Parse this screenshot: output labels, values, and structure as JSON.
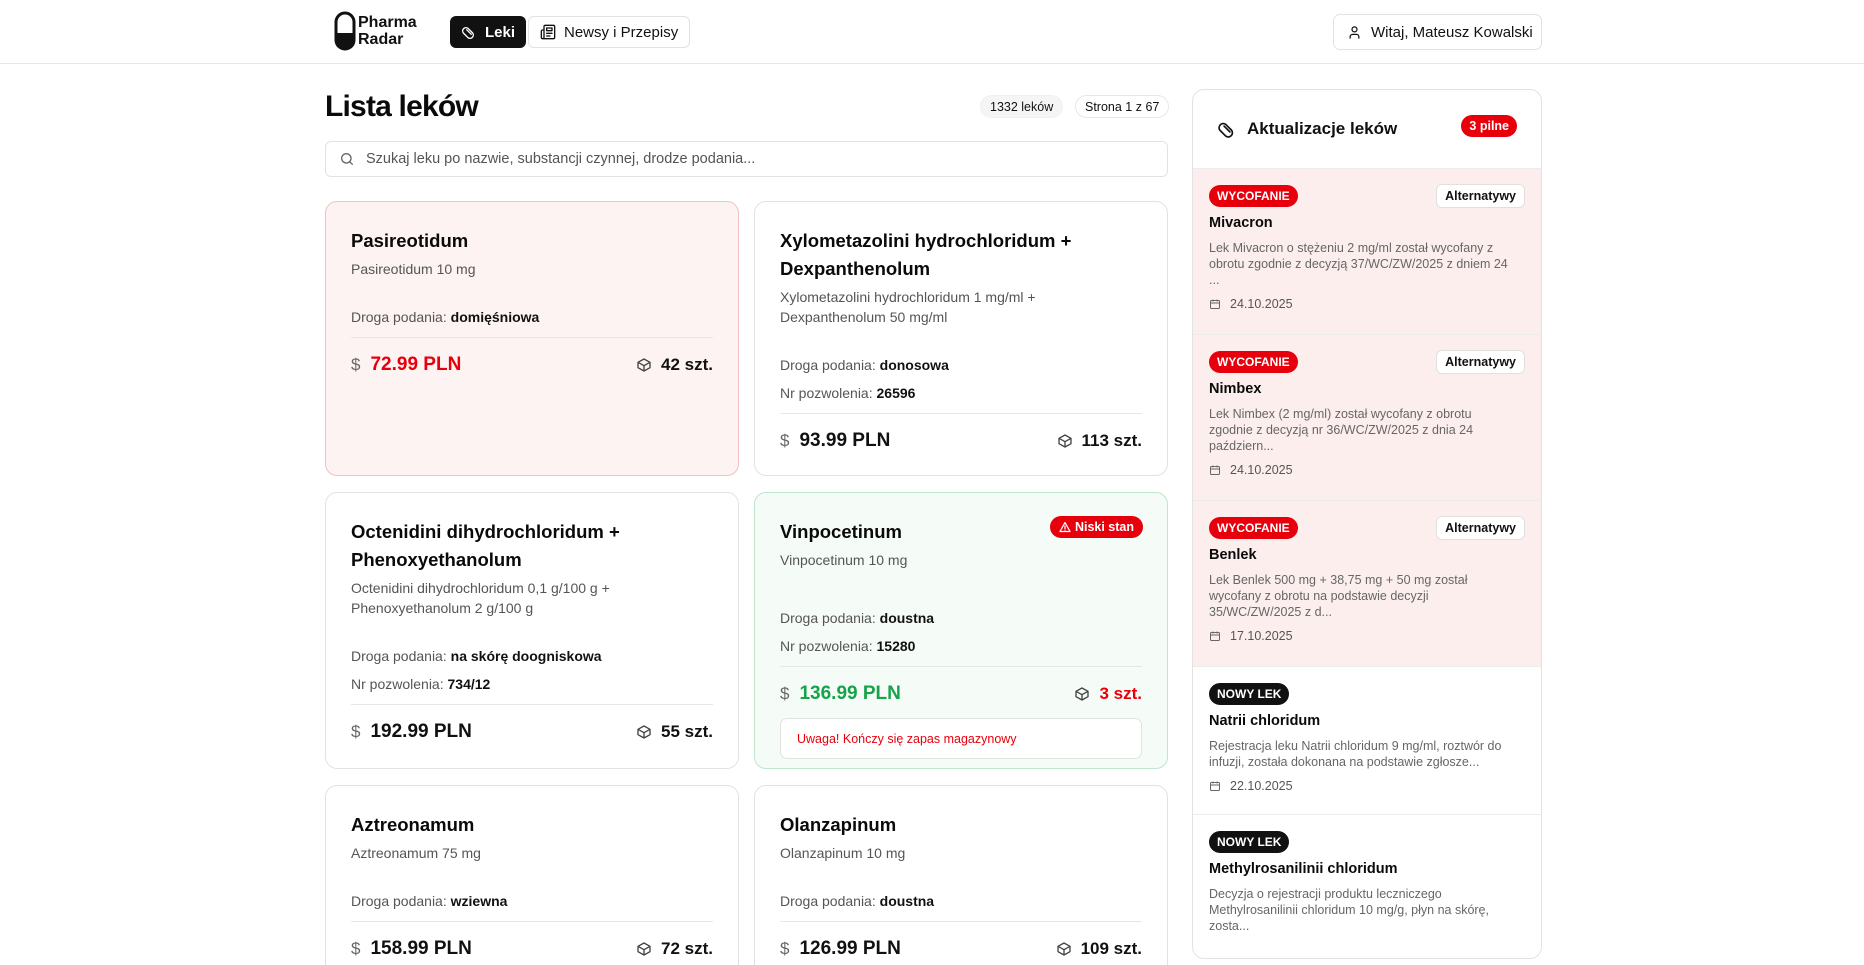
{
  "header": {
    "logo_line1": "Pharma",
    "logo_line2": "Radar",
    "nav": [
      {
        "label": "Leki",
        "icon": "pill-icon"
      },
      {
        "label": "Newsy i Przepisy",
        "icon": "newspaper-icon"
      }
    ],
    "user_label": "Witaj, Mateusz Kowalski"
  },
  "main": {
    "title": "Lista leków",
    "count_pill": "1332 leków",
    "page_pill": "Strona 1 z 67",
    "search_placeholder": "Szukaj leku po nazwie, substancji czynnej, drodze podania...",
    "route_label": "Droga podania:",
    "permit_label": "Nr pozwolenia:",
    "cards": [
      {
        "name": "Pasireotidum",
        "sub": "Pasireotidum 10 mg",
        "route": "domięśniowa",
        "permit": "",
        "price": "72.99 PLN",
        "stock": "42 szt.",
        "state": "withdrawn"
      },
      {
        "name": "Xylometazolini hydrochloridum + Dexpanthenolum",
        "sub": "Xylometazolini hydrochloridum 1 mg/ml + Dexpanthenolum 50 mg/ml",
        "route": "donosowa",
        "permit": "26596",
        "price": "93.99 PLN",
        "stock": "113 szt.",
        "state": "normal"
      },
      {
        "name": "Octenidini dihydrochloridum + Phenoxyethanolum",
        "sub": "Octenidini dihydrochloridum 0,1 g/100 g + Phenoxyethanolum 2 g/100 g",
        "route": "na skórę doogniskowa",
        "permit": "734/12",
        "price": "192.99 PLN",
        "stock": "55 szt.",
        "state": "normal"
      },
      {
        "name": "Vinpocetinum",
        "sub": "Vinpocetinum 10 mg",
        "route": "doustna",
        "permit": "15280",
        "price": "136.99 PLN",
        "stock": "3 szt.",
        "state": "low",
        "badge": "Niski stan",
        "warning": "Uwaga! Kończy się zapas magazynowy"
      },
      {
        "name": "Aztreonamum",
        "sub": "Aztreonamum 75 mg",
        "route": "wziewna",
        "permit": "",
        "price": "158.99 PLN",
        "stock": "72 szt.",
        "state": "normal"
      },
      {
        "name": "Olanzapinum",
        "sub": "Olanzapinum 10 mg",
        "route": "doustna",
        "permit": "",
        "price": "126.99 PLN",
        "stock": "109 szt.",
        "state": "normal"
      }
    ]
  },
  "panel": {
    "title": "Aktualizacje leków",
    "urgent_badge": "3 pilne",
    "alt_label": "Alternatywy",
    "updates": [
      {
        "tag": "WYCOFANIE",
        "name": "Mivacron",
        "desc": "Lek Mivacron o stężeniu 2 mg/ml został wycofany z obrotu zgodnie z decyzją 37/WC/ZW/2025 z dniem 24 ...",
        "date": "24.10.2025",
        "type": "withdrawal"
      },
      {
        "tag": "WYCOFANIE",
        "name": "Nimbex",
        "desc": "Lek Nimbex (2 mg/ml) został wycofany z obrotu zgodnie z decyzją nr 36/WC/ZW/2025 z dnia 24 październ...",
        "date": "24.10.2025",
        "type": "withdrawal"
      },
      {
        "tag": "WYCOFANIE",
        "name": "Benlek",
        "desc": "Lek Benlek 500 mg + 38,75 mg + 50 mg został wycofany z obrotu na podstawie decyzji 35/WC/ZW/2025 z d...",
        "date": "17.10.2025",
        "type": "withdrawal"
      },
      {
        "tag": "NOWY LEK",
        "name": "Natrii chloridum",
        "desc": "Rejestracja leku Natrii chloridum 9 mg/ml, roztwór do infuzji, została dokonana na podstawie zgłosze...",
        "date": "22.10.2025",
        "type": "new"
      },
      {
        "tag": "NOWY LEK",
        "name": "Methylrosanilinii chloridum",
        "desc": "Decyzja o rejestracji produktu leczniczego Methylrosanilinii chloridum 10 mg/g, płyn na skórę, zosta...",
        "date": "",
        "type": "new"
      }
    ]
  },
  "colors": {
    "accent_red": "#e7000b",
    "accent_green": "#16a34a",
    "dark": "#111111"
  }
}
